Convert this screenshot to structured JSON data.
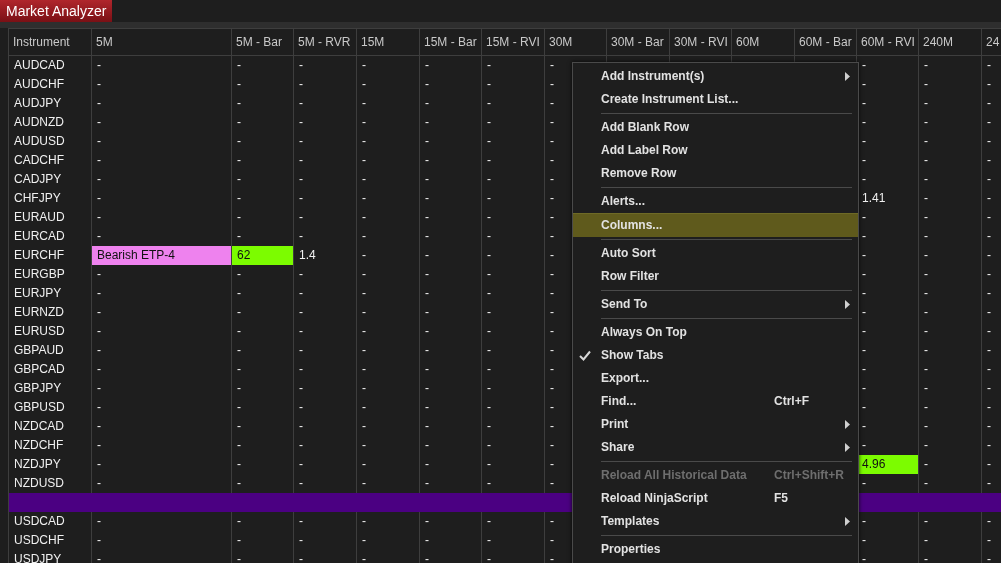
{
  "tabs": [
    {
      "label": "Market Analyzer",
      "selected": true
    }
  ],
  "table": {
    "columns": [
      "Instrument",
      "5M",
      "5M - Bar",
      "5M - RVR",
      "15M",
      "15M - Bar",
      "15M - RVI",
      "30M",
      "30M - Bar",
      "30M - RVI",
      "60M",
      "60M - Bar",
      "60M - RVI",
      "240M",
      "24"
    ],
    "rows": [
      {
        "kind": "instrument",
        "instrument": "AUDCAD",
        "cells": [
          "-",
          "-",
          "-",
          "-",
          "-",
          "-",
          "-",
          null,
          null,
          null,
          null,
          "-",
          "-",
          "-"
        ]
      },
      {
        "kind": "instrument",
        "instrument": "AUDCHF",
        "cells": [
          "-",
          "-",
          "-",
          "-",
          "-",
          "-",
          "-",
          null,
          null,
          null,
          null,
          "-",
          "-",
          "-"
        ]
      },
      {
        "kind": "instrument",
        "instrument": "AUDJPY",
        "cells": [
          "-",
          "-",
          "-",
          "-",
          "-",
          "-",
          "-",
          null,
          null,
          null,
          null,
          "-",
          "-",
          "-"
        ]
      },
      {
        "kind": "instrument",
        "instrument": "AUDNZD",
        "cells": [
          "-",
          "-",
          "-",
          "-",
          "-",
          "-",
          "-",
          null,
          null,
          null,
          null,
          "-",
          "-",
          "-"
        ]
      },
      {
        "kind": "instrument",
        "instrument": "AUDUSD",
        "cells": [
          "-",
          "-",
          "-",
          "-",
          "-",
          "-",
          "-",
          null,
          null,
          null,
          null,
          "-",
          "-",
          "-"
        ]
      },
      {
        "kind": "instrument",
        "instrument": "CADCHF",
        "cells": [
          "-",
          "-",
          "-",
          "-",
          "-",
          "-",
          "-",
          null,
          null,
          null,
          null,
          "-",
          "-",
          "-"
        ]
      },
      {
        "kind": "instrument",
        "instrument": "CADJPY",
        "cells": [
          "-",
          "-",
          "-",
          "-",
          "-",
          "-",
          "-",
          null,
          null,
          null,
          null,
          "-",
          "-",
          "-"
        ]
      },
      {
        "kind": "instrument",
        "instrument": "CHFJPY",
        "cells": [
          "-",
          "-",
          "-",
          "-",
          "-",
          "-",
          "-",
          null,
          null,
          null,
          null,
          "1.41",
          "-",
          "-"
        ]
      },
      {
        "kind": "instrument",
        "instrument": "EURAUD",
        "cells": [
          "-",
          "-",
          "-",
          "-",
          "-",
          "-",
          "-",
          null,
          null,
          null,
          null,
          "-",
          "-",
          "-"
        ]
      },
      {
        "kind": "instrument",
        "instrument": "EURCAD",
        "cells": [
          "-",
          "-",
          "-",
          "-",
          "-",
          "-",
          "-",
          null,
          null,
          null,
          null,
          "-",
          "-",
          "-"
        ]
      },
      {
        "kind": "instrument",
        "instrument": "EURCHF",
        "cells": [
          {
            "text": "Bearish ETP-4",
            "color": "#ee82ee"
          },
          {
            "text": "62",
            "color": "#7cfc00"
          },
          "1.4",
          "-",
          "-",
          "-",
          "-",
          null,
          null,
          null,
          null,
          "-",
          "-",
          "-"
        ]
      },
      {
        "kind": "instrument",
        "instrument": "EURGBP",
        "cells": [
          "-",
          "-",
          "-",
          "-",
          "-",
          "-",
          "-",
          null,
          null,
          null,
          null,
          "-",
          "-",
          "-"
        ]
      },
      {
        "kind": "instrument",
        "instrument": "EURJPY",
        "cells": [
          "-",
          "-",
          "-",
          "-",
          "-",
          "-",
          "-",
          null,
          null,
          null,
          null,
          "-",
          "-",
          "-"
        ]
      },
      {
        "kind": "instrument",
        "instrument": "EURNZD",
        "cells": [
          "-",
          "-",
          "-",
          "-",
          "-",
          "-",
          "-",
          null,
          null,
          null,
          null,
          "-",
          "-",
          "-"
        ]
      },
      {
        "kind": "instrument",
        "instrument": "EURUSD",
        "cells": [
          "-",
          "-",
          "-",
          "-",
          "-",
          "-",
          "-",
          null,
          null,
          null,
          null,
          "-",
          "-",
          "-"
        ]
      },
      {
        "kind": "instrument",
        "instrument": "GBPAUD",
        "cells": [
          "-",
          "-",
          "-",
          "-",
          "-",
          "-",
          "-",
          null,
          null,
          null,
          null,
          "-",
          "-",
          "-"
        ]
      },
      {
        "kind": "instrument",
        "instrument": "GBPCAD",
        "cells": [
          "-",
          "-",
          "-",
          "-",
          "-",
          "-",
          "-",
          null,
          null,
          null,
          null,
          "-",
          "-",
          "-"
        ]
      },
      {
        "kind": "instrument",
        "instrument": "GBPJPY",
        "cells": [
          "-",
          "-",
          "-",
          "-",
          "-",
          "-",
          "-",
          null,
          null,
          null,
          null,
          "-",
          "-",
          "-"
        ]
      },
      {
        "kind": "instrument",
        "instrument": "GBPUSD",
        "cells": [
          "-",
          "-",
          "-",
          "-",
          "-",
          "-",
          "-",
          null,
          null,
          null,
          null,
          "-",
          "-",
          "-"
        ]
      },
      {
        "kind": "instrument",
        "instrument": "NZDCAD",
        "cells": [
          "-",
          "-",
          "-",
          "-",
          "-",
          "-",
          "-",
          null,
          null,
          null,
          null,
          "-",
          "-",
          "-"
        ]
      },
      {
        "kind": "instrument",
        "instrument": "NZDCHF",
        "cells": [
          "-",
          "-",
          "-",
          "-",
          "-",
          "-",
          "-",
          null,
          null,
          null,
          null,
          "-",
          "-",
          "-"
        ]
      },
      {
        "kind": "instrument",
        "instrument": "NZDJPY",
        "cells": [
          "-",
          "-",
          "-",
          "-",
          "-",
          "-",
          "-",
          null,
          null,
          null,
          null,
          {
            "text": "4.96",
            "color": "#7cfc00"
          },
          "-",
          "-"
        ]
      },
      {
        "kind": "instrument",
        "instrument": "NZDUSD",
        "cells": [
          "-",
          "-",
          "-",
          "-",
          "-",
          "-",
          "-",
          null,
          null,
          null,
          null,
          "-",
          "-",
          "-"
        ]
      },
      {
        "kind": "label",
        "color": "#4b0082"
      },
      {
        "kind": "instrument",
        "instrument": "USDCAD",
        "cells": [
          "-",
          "-",
          "-",
          "-",
          "-",
          "-",
          "-",
          null,
          null,
          null,
          null,
          "-",
          "-",
          "-"
        ]
      },
      {
        "kind": "instrument",
        "instrument": "USDCHF",
        "cells": [
          "-",
          "-",
          "-",
          "-",
          "-",
          "-",
          "-",
          null,
          null,
          null,
          null,
          "-",
          "-",
          "-"
        ]
      },
      {
        "kind": "instrument",
        "instrument": "USDJPY",
        "cells": [
          "-",
          "-",
          "-",
          "-",
          "-",
          "-",
          "-",
          null,
          null,
          null,
          null,
          "-",
          "-",
          "-"
        ]
      }
    ]
  },
  "context_menu": {
    "items": [
      {
        "kind": "item",
        "label": "Add Instrument(s)",
        "submenu": true,
        "selected": false,
        "checked": false,
        "disabled": false
      },
      {
        "kind": "item",
        "label": "Create Instrument List...",
        "submenu": false,
        "selected": false,
        "checked": false,
        "disabled": false
      },
      {
        "kind": "separator"
      },
      {
        "kind": "item",
        "label": "Add Blank Row",
        "submenu": false,
        "selected": false,
        "checked": false,
        "disabled": false
      },
      {
        "kind": "item",
        "label": "Add Label Row",
        "submenu": false,
        "selected": false,
        "checked": false,
        "disabled": false
      },
      {
        "kind": "item",
        "label": "Remove Row",
        "submenu": false,
        "selected": false,
        "checked": false,
        "disabled": false
      },
      {
        "kind": "separator"
      },
      {
        "kind": "item",
        "label": "Alerts...",
        "submenu": false,
        "selected": false,
        "checked": false,
        "disabled": false
      },
      {
        "kind": "item",
        "label": "Columns...",
        "submenu": false,
        "selected": true,
        "checked": false,
        "disabled": false
      },
      {
        "kind": "separator"
      },
      {
        "kind": "item",
        "label": "Auto Sort",
        "submenu": false,
        "selected": false,
        "checked": false,
        "disabled": false
      },
      {
        "kind": "item",
        "label": "Row Filter",
        "submenu": false,
        "selected": false,
        "checked": false,
        "disabled": false
      },
      {
        "kind": "separator"
      },
      {
        "kind": "item",
        "label": "Send To",
        "submenu": true,
        "selected": false,
        "checked": false,
        "disabled": false
      },
      {
        "kind": "separator"
      },
      {
        "kind": "item",
        "label": "Always On Top",
        "submenu": false,
        "selected": false,
        "checked": false,
        "disabled": false
      },
      {
        "kind": "item",
        "label": "Show Tabs",
        "submenu": false,
        "selected": false,
        "checked": true,
        "disabled": false
      },
      {
        "kind": "item",
        "label": "Export...",
        "submenu": false,
        "selected": false,
        "checked": false,
        "disabled": false
      },
      {
        "kind": "item",
        "label": "Find...",
        "shortcut": "Ctrl+F",
        "submenu": false,
        "selected": false,
        "checked": false,
        "disabled": false
      },
      {
        "kind": "item",
        "label": "Print",
        "submenu": true,
        "selected": false,
        "checked": false,
        "disabled": false
      },
      {
        "kind": "item",
        "label": "Share",
        "submenu": true,
        "selected": false,
        "checked": false,
        "disabled": false
      },
      {
        "kind": "separator"
      },
      {
        "kind": "item",
        "label": "Reload All Historical Data",
        "shortcut": "Ctrl+Shift+R",
        "submenu": false,
        "selected": false,
        "checked": false,
        "disabled": true
      },
      {
        "kind": "item",
        "label": "Reload NinjaScript",
        "shortcut": "F5",
        "submenu": false,
        "selected": false,
        "checked": false,
        "disabled": false
      },
      {
        "kind": "item",
        "label": "Templates",
        "submenu": true,
        "selected": false,
        "checked": false,
        "disabled": false
      },
      {
        "kind": "separator"
      },
      {
        "kind": "item",
        "label": "Properties",
        "submenu": false,
        "selected": false,
        "checked": false,
        "disabled": false
      }
    ]
  }
}
